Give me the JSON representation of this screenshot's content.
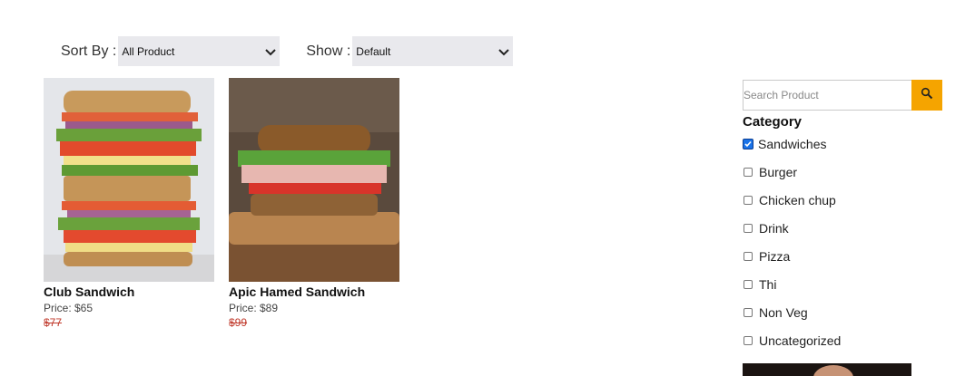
{
  "toolbar": {
    "sort_label": "Sort By :",
    "sort_value": "All Product",
    "show_label": "Show :",
    "show_value": "Default"
  },
  "products": [
    {
      "name": "Club Sandwich",
      "price": "Price: $65",
      "old_price": "$77"
    },
    {
      "name": "Apic Hamed Sandwich",
      "price": "Price: $89",
      "old_price": "$99"
    }
  ],
  "sidebar": {
    "search_placeholder": "Search Product",
    "category_title": "Category",
    "categories": [
      {
        "label": "Sandwiches",
        "checked": true
      },
      {
        "label": "Burger",
        "checked": false
      },
      {
        "label": "Chicken chup",
        "checked": false
      },
      {
        "label": "Drink",
        "checked": false
      },
      {
        "label": "Pizza",
        "checked": false
      },
      {
        "label": "Thi",
        "checked": false
      },
      {
        "label": "Non Veg",
        "checked": false
      },
      {
        "label": "Uncategorized",
        "checked": false
      }
    ]
  },
  "colors": {
    "accent": "#f5a400",
    "old_price": "#c0392b",
    "select_bg": "#e9e9ed"
  }
}
